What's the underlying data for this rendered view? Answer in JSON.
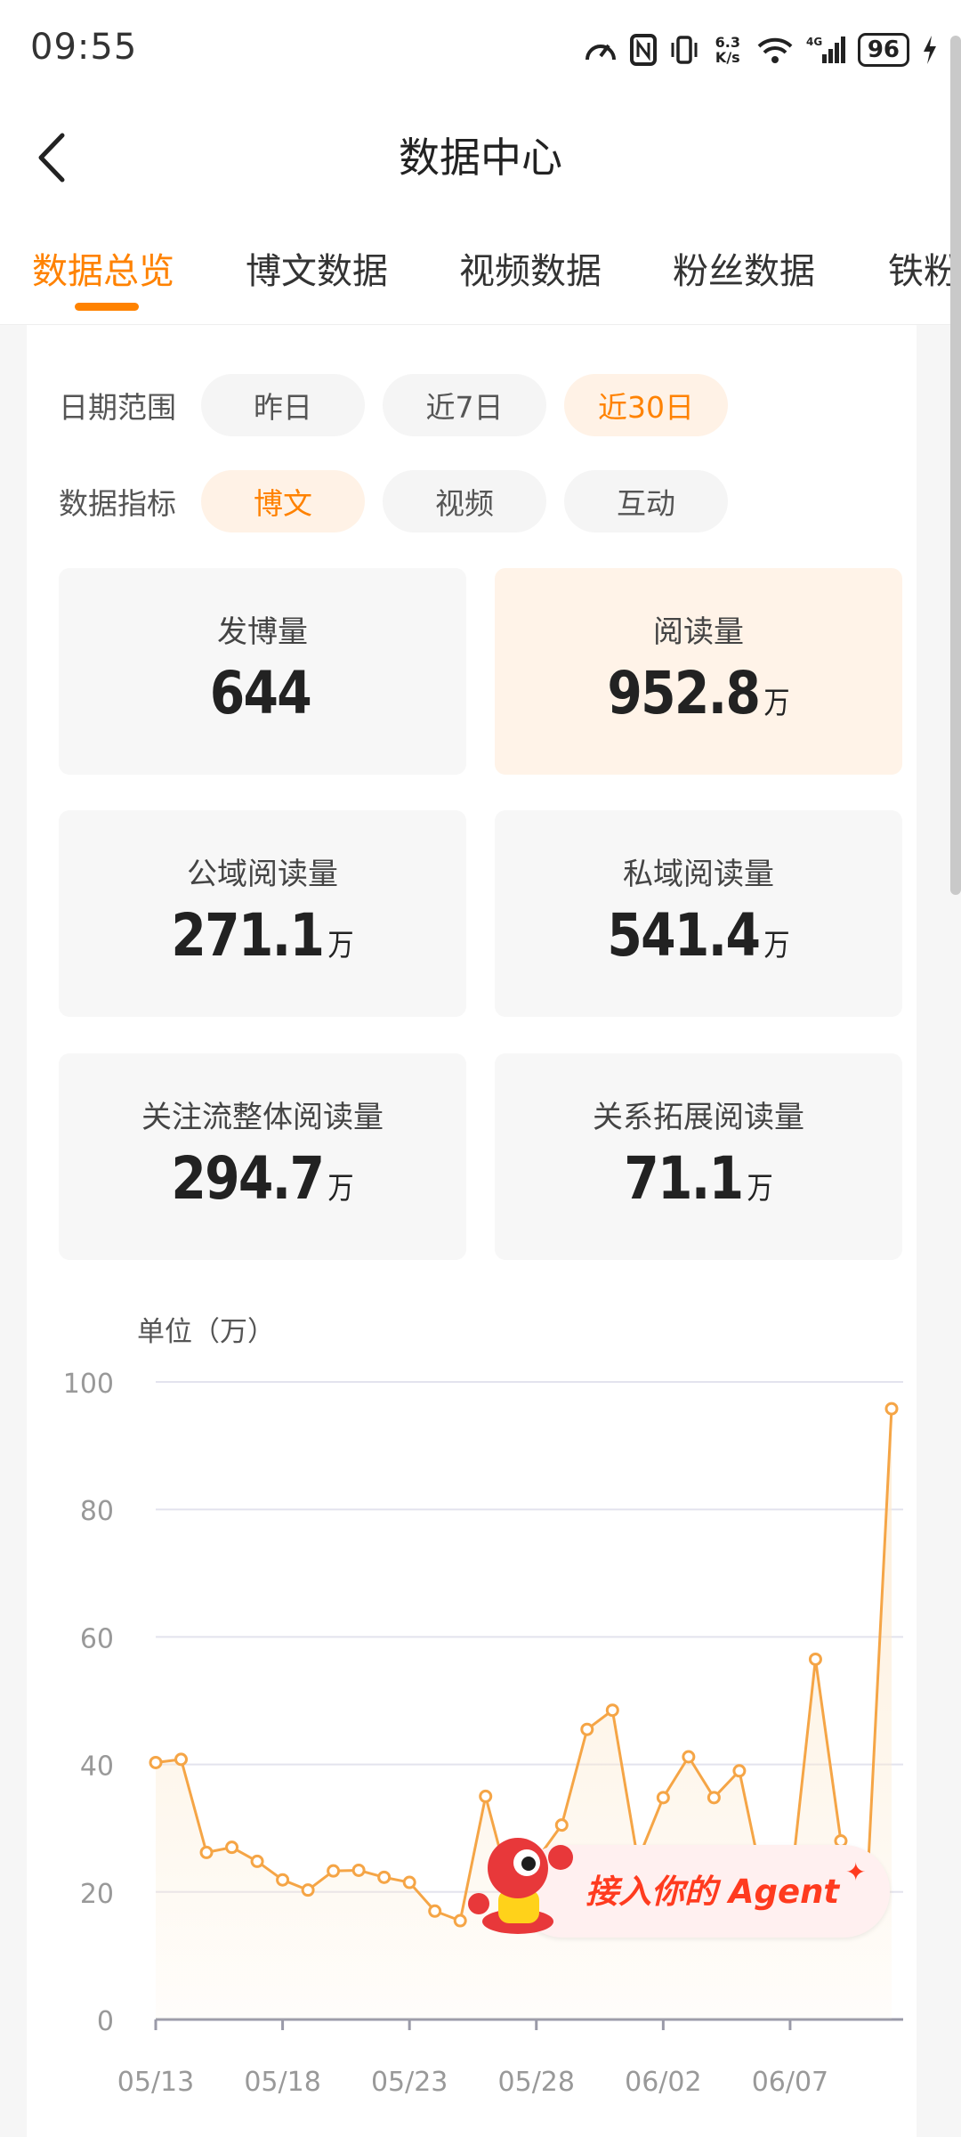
{
  "status": {
    "time": "09:55",
    "speed": "6.3\nK/s",
    "battery": "96"
  },
  "header": {
    "title": "数据中心"
  },
  "tabs": [
    "数据总览",
    "博文数据",
    "视频数据",
    "粉丝数据",
    "铁粉"
  ],
  "filters": {
    "date_label": "日期范围",
    "date_options": [
      "昨日",
      "近7日",
      "近30日"
    ],
    "date_selected": "近30日",
    "metric_label": "数据指标",
    "metric_options": [
      "博文",
      "视频",
      "互动"
    ],
    "metric_selected": "博文"
  },
  "stats": [
    {
      "label": "发博量",
      "value": "644",
      "unit": ""
    },
    {
      "label": "阅读量",
      "value": "952.8",
      "unit": "万"
    },
    {
      "label": "公域阅读量",
      "value": "271.1",
      "unit": "万"
    },
    {
      "label": "私域阅读量",
      "value": "541.4",
      "unit": "万"
    },
    {
      "label": "关注流整体阅读量",
      "value": "294.7",
      "unit": "万"
    },
    {
      "label": "关系拓展阅读量",
      "value": "71.1",
      "unit": "万"
    }
  ],
  "chart_unit": "单位（万）",
  "chart_data": {
    "type": "line",
    "x_ticks": [
      "05/13",
      "05/18",
      "05/23",
      "05/28",
      "06/02",
      "06/07"
    ],
    "x": [
      "05/13",
      "05/14",
      "05/15",
      "05/16",
      "05/17",
      "05/18",
      "05/19",
      "05/20",
      "05/21",
      "05/22",
      "05/23",
      "05/24",
      "05/25",
      "05/26",
      "05/27",
      "05/28",
      "05/29",
      "05/30",
      "05/31",
      "06/01",
      "06/02",
      "06/03",
      "06/04",
      "06/05",
      "06/06",
      "06/07",
      "06/08",
      "06/09",
      "06/10",
      "06/11"
    ],
    "values": [
      40.3,
      40.8,
      26.2,
      27.0,
      24.8,
      21.9,
      20.3,
      23.3,
      23.4,
      22.3,
      21.5,
      17.0,
      15.5,
      35.0,
      20.0,
      25.0,
      30.5,
      45.5,
      48.5,
      25.0,
      34.8,
      41.2,
      34.8,
      39.0,
      20.0,
      20.0,
      56.5,
      28.0,
      18.0,
      95.8
    ],
    "ylim": [
      0,
      100
    ],
    "y_ticks": [
      0,
      20,
      40,
      60,
      80,
      100
    ],
    "grid": true,
    "colors": {
      "line": "#f5a546",
      "point_fill": "#ffffff",
      "area": "#fdebd2",
      "grid": "#e3e3ee",
      "axis": "#9a9aa8"
    }
  },
  "agent_badge": {
    "text": "接入你的 Agent"
  }
}
